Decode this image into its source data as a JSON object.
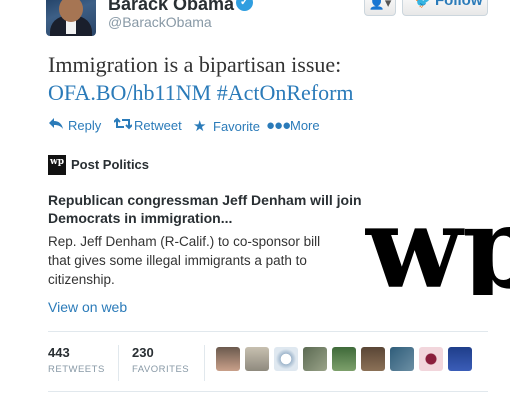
{
  "user": {
    "name": "Barack Obama",
    "handle": "@BarackObama"
  },
  "header_buttons": {
    "follow_label": "Follow"
  },
  "tweet": {
    "line1": "Immigration is a bipartisan issue:",
    "link": "OFA.BO/hb11NM",
    "hashtag": "#ActOnReform"
  },
  "actions": {
    "reply": "Reply",
    "retweet": "Retweet",
    "favorite": "Favorite",
    "more": "More"
  },
  "card": {
    "source": "Post Politics",
    "badge_text": "wp",
    "title": "Republican congressman Jeff Denham will join Democrats in immigration...",
    "description": "Rep. Jeff Denham (R-Calif.) to co-sponsor bill that gives some illegal immigrants a path to citizenship.",
    "view_link": "View on web",
    "logo_text": "wp"
  },
  "stats": {
    "retweets_count": "443",
    "retweets_label": "RETWEETS",
    "favorites_count": "230",
    "favorites_label": "FAVORITES"
  },
  "colors": {
    "link": "#2b7bb9",
    "verified": "#2f9ee0"
  },
  "icons": {
    "reply": "reply-arrow-icon",
    "retweet": "retweet-arrows-icon",
    "favorite": "star-icon",
    "more": "dots-icon",
    "verified": "check-icon"
  }
}
